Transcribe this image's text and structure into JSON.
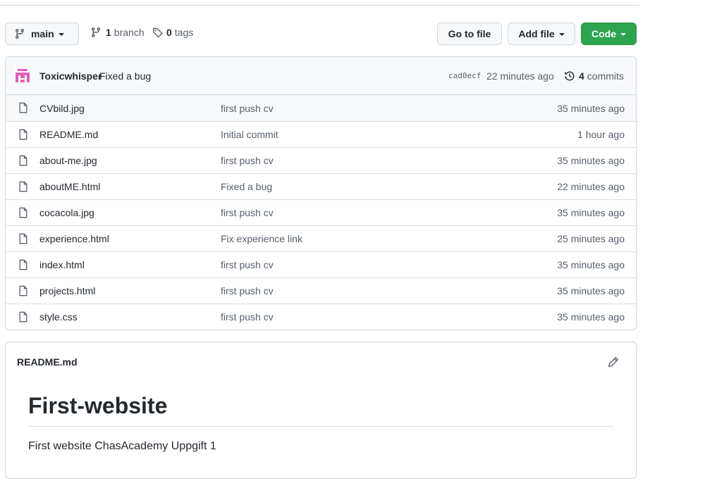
{
  "toolbar": {
    "branch_label": "main",
    "branch_count": "1",
    "branch_word": "branch",
    "tag_count": "0",
    "tag_word": "tags",
    "goto_label": "Go to file",
    "addfile_label": "Add file",
    "code_label": "Code"
  },
  "commit": {
    "author": "Toxicwhisper",
    "message": "Fixed a bug",
    "sha": "cad0ecf",
    "time": "22 minutes ago",
    "count": "4",
    "count_word": "commits"
  },
  "files": [
    {
      "name": "CVbild.jpg",
      "message": "first push cv",
      "time": "35 minutes ago"
    },
    {
      "name": "README.md",
      "message": "Initial commit",
      "time": "1 hour ago"
    },
    {
      "name": "about-me.jpg",
      "message": "first push cv",
      "time": "35 minutes ago"
    },
    {
      "name": "aboutME.html",
      "message": "Fixed a bug",
      "time": "22 minutes ago"
    },
    {
      "name": "cocacola.jpg",
      "message": "first push cv",
      "time": "35 minutes ago"
    },
    {
      "name": "experience.html",
      "message": "Fix experience link",
      "time": "25 minutes ago"
    },
    {
      "name": "index.html",
      "message": "first push cv",
      "time": "35 minutes ago"
    },
    {
      "name": "projects.html",
      "message": "first push cv",
      "time": "35 minutes ago"
    },
    {
      "name": "style.css",
      "message": "first push cv",
      "time": "35 minutes ago"
    }
  ],
  "readme": {
    "filename": "README.md",
    "heading": "First-website",
    "body": "First website ChasAcademy Uppgift 1"
  },
  "colors": {
    "code_button": "#2da44e",
    "avatar": "#e05fb8"
  }
}
